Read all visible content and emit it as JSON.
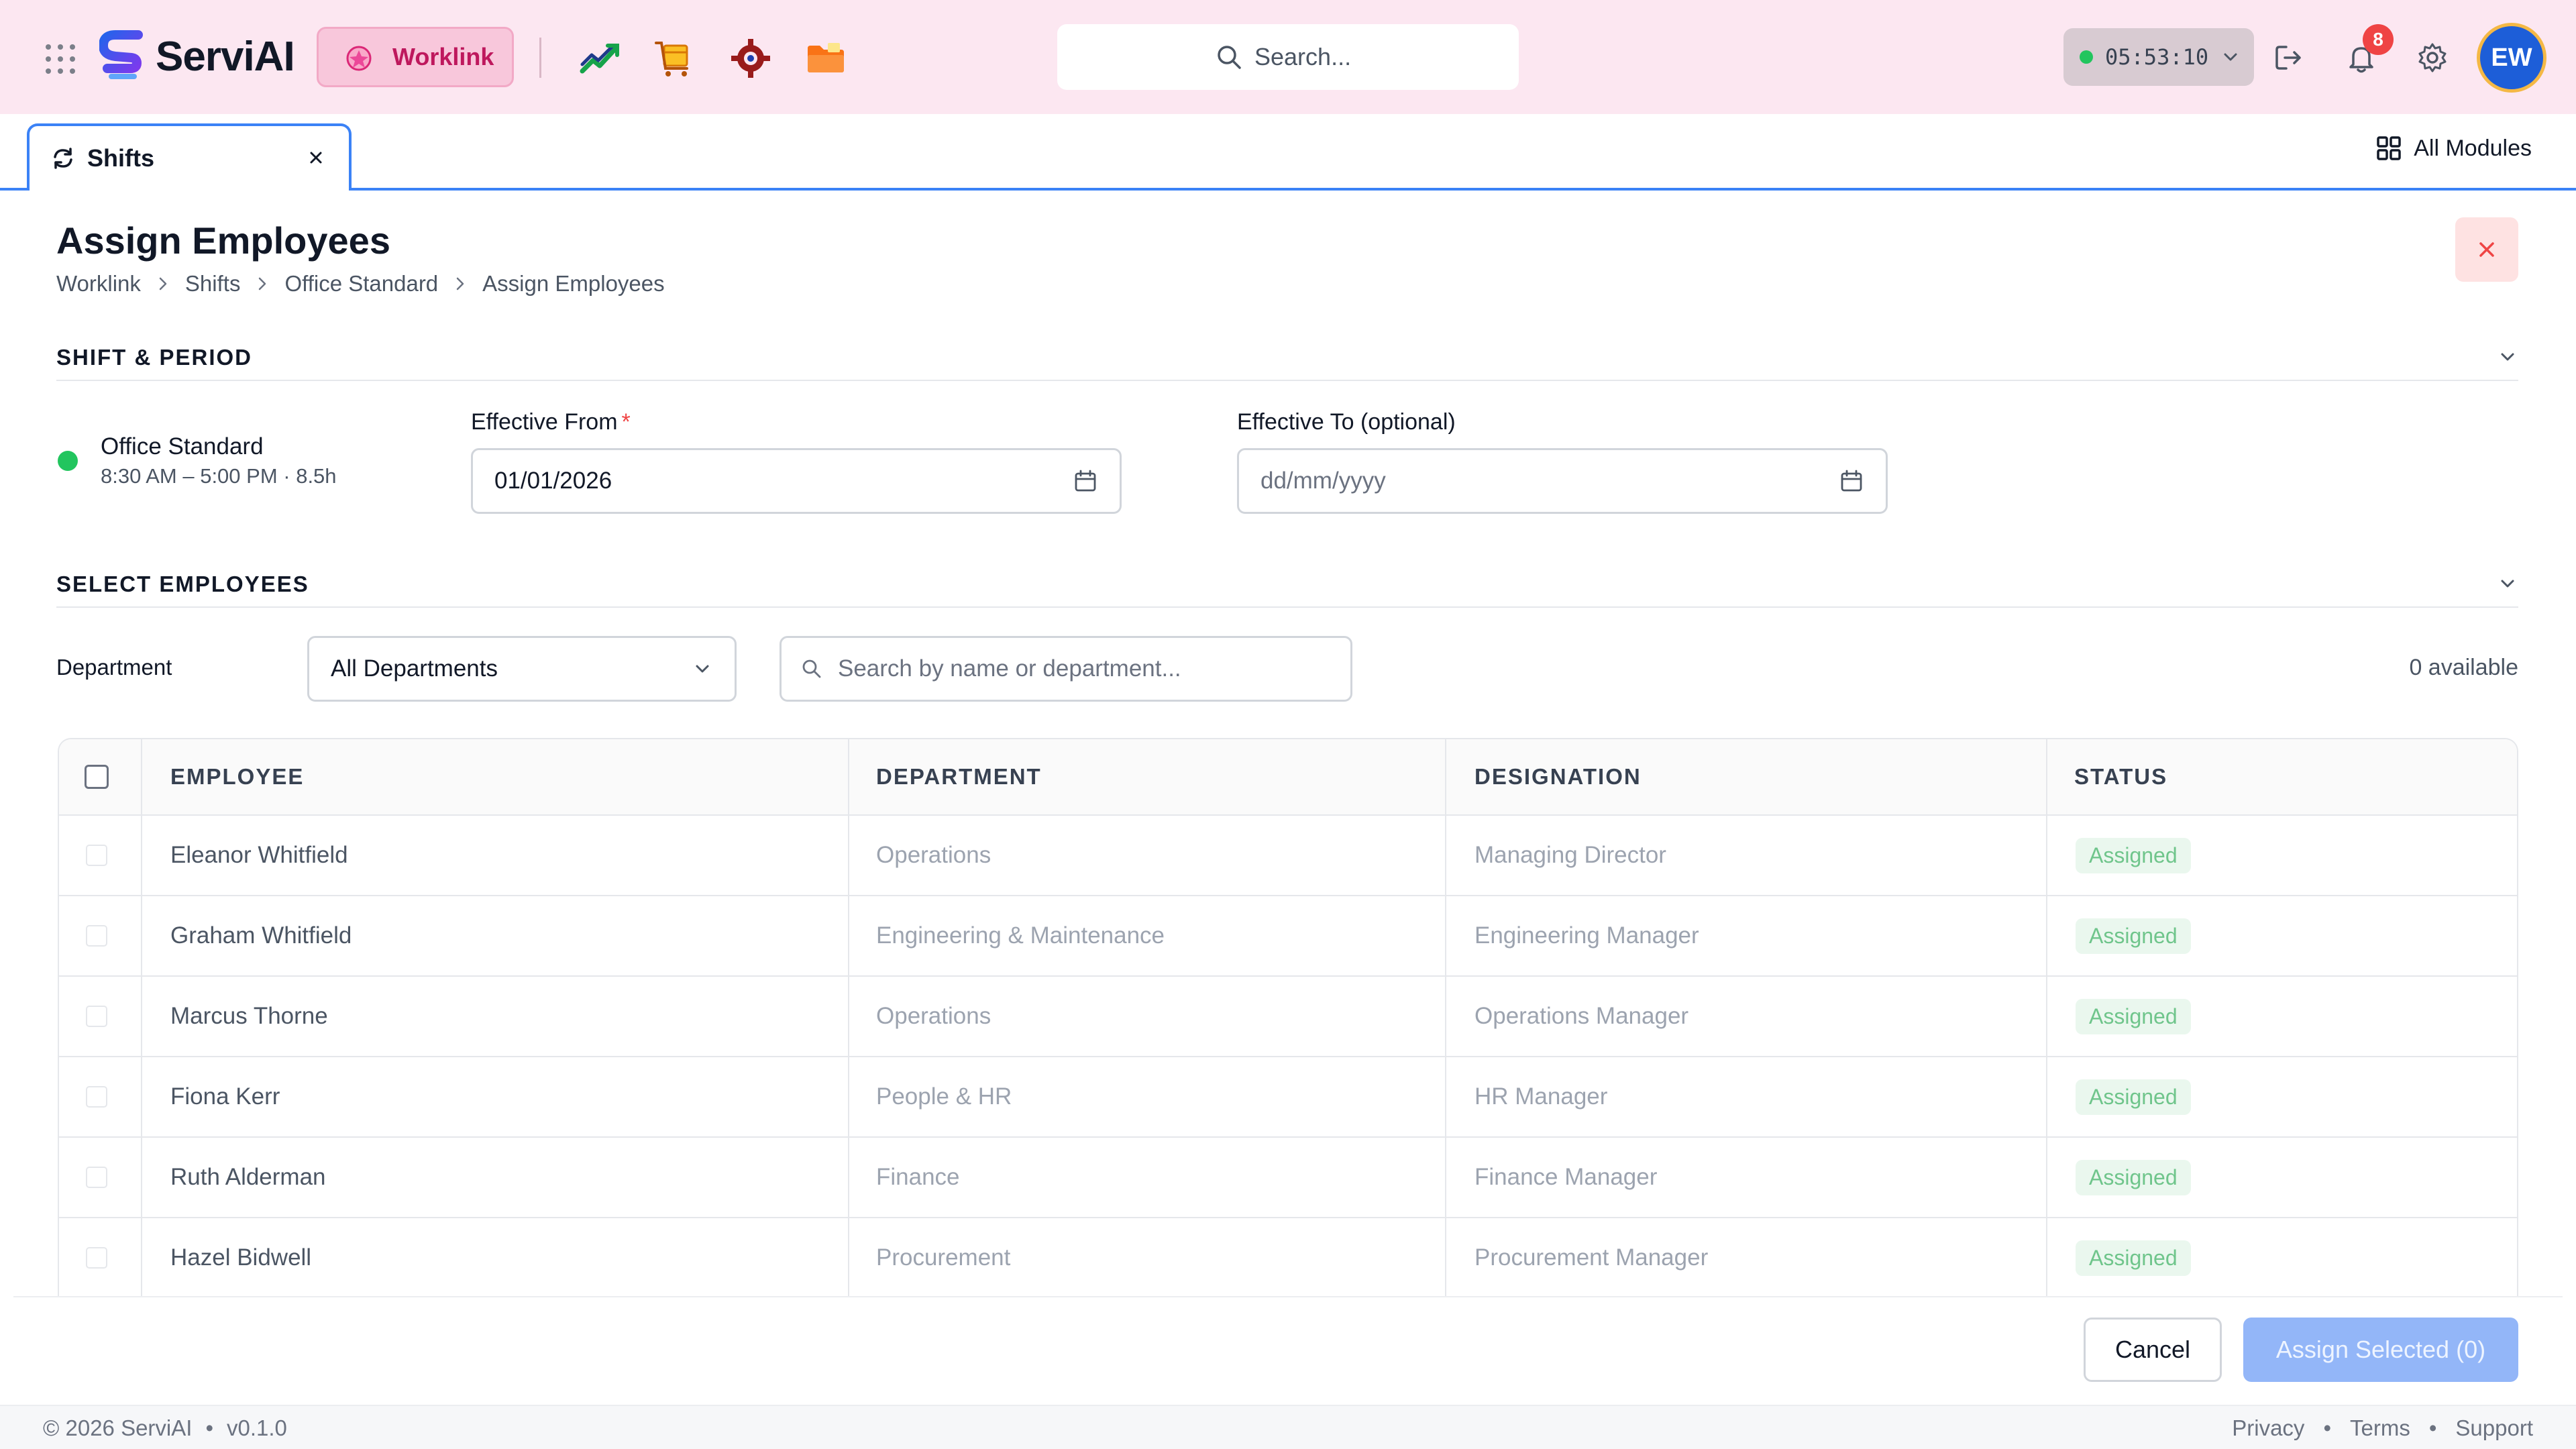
{
  "header": {
    "logo_text": "ServiAI",
    "module_chip": "Worklink",
    "search_placeholder": "Search...",
    "timer": "05:53:10",
    "notification_count": "8",
    "avatar_initials": "EW"
  },
  "tabs": {
    "active_label": "Shifts",
    "all_modules_label": "All Modules"
  },
  "page": {
    "title": "Assign Employees",
    "breadcrumb": [
      "Worklink",
      "Shifts",
      "Office Standard",
      "Assign Employees"
    ]
  },
  "shift_period": {
    "section_title": "SHIFT & PERIOD",
    "shift_name": "Office Standard",
    "shift_meta": "8:30 AM – 5:00 PM · 8.5h",
    "effective_from_label": "Effective From",
    "required_mark": "*",
    "effective_from_value": "01/01/2026",
    "effective_to_label": "Effective To (optional)",
    "effective_to_placeholder": "dd/mm/yyyy"
  },
  "select_employees": {
    "section_title": "SELECT EMPLOYEES",
    "department_label": "Department",
    "department_value": "All Departments",
    "search_placeholder": "Search by name or department...",
    "available_text": "0 available"
  },
  "table": {
    "columns": [
      "EMPLOYEE",
      "DEPARTMENT",
      "DESIGNATION",
      "STATUS"
    ],
    "rows": [
      {
        "employee": "Eleanor Whitfield",
        "department": "Operations",
        "designation": "Managing Director",
        "status": "Assigned"
      },
      {
        "employee": "Graham Whitfield",
        "department": "Engineering & Maintenance",
        "designation": "Engineering Manager",
        "status": "Assigned"
      },
      {
        "employee": "Marcus Thorne",
        "department": "Operations",
        "designation": "Operations Manager",
        "status": "Assigned"
      },
      {
        "employee": "Fiona Kerr",
        "department": "People & HR",
        "designation": "HR Manager",
        "status": "Assigned"
      },
      {
        "employee": "Ruth Alderman",
        "department": "Finance",
        "designation": "Finance Manager",
        "status": "Assigned"
      },
      {
        "employee": "Hazel Bidwell",
        "department": "Procurement",
        "designation": "Procurement Manager",
        "status": "Assigned"
      }
    ]
  },
  "actions": {
    "cancel_label": "Cancel",
    "assign_label": "Assign Selected (0)"
  },
  "footer": {
    "copyright": "© 2026 ServiAI",
    "version": "v0.1.0",
    "links": [
      "Privacy",
      "Terms",
      "Support"
    ]
  },
  "colors": {
    "header_bg": "#fce7f1",
    "accent_blue": "#3b82f6",
    "module_pink": "#be185d",
    "status_green": "#22c55e"
  },
  "icons": [
    "apps-grid-icon",
    "analytics-icon",
    "procurement-icon",
    "settings-gear-icon",
    "folder-icon",
    "search-icon",
    "logout-icon",
    "bell-icon",
    "gear-icon",
    "shifts-icon",
    "close-icon",
    "all-modules-icon",
    "calendar-icon",
    "chevron-down-icon",
    "chevron-right-icon"
  ]
}
